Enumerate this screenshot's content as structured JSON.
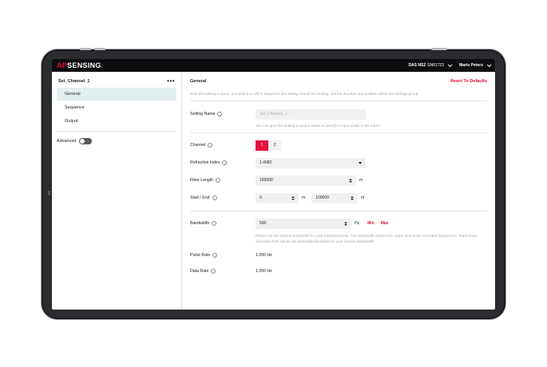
{
  "topbar": {
    "logo_ap": "AP",
    "logo_rest": "SENSING",
    "logo_dot": ".",
    "device_model": "DAS NS2",
    "device_serial": "SN81723",
    "user": "Mario Peters"
  },
  "sidebar": {
    "setting_name": "Set_Channel_1",
    "menu_label": "•••",
    "items": [
      "General",
      "Sequence",
      "Output"
    ],
    "active": "General",
    "advanced_label": "Advanced"
  },
  "main": {
    "title": "General",
    "reset_label": "Reset To Defaults",
    "description": "Give this setting a name, and define in which sequence this setting should be running. Set the duration and position within the settings group.",
    "setting_name": {
      "label": "Setting Name",
      "placeholder": "Set_Channel_1",
      "hint": "You can give this setting a unique name to identify it more easily in the future."
    },
    "channel": {
      "label": "Channel",
      "options": [
        "1",
        "2"
      ],
      "selected": "1"
    },
    "refractive_index": {
      "label": "Refractive Index",
      "value": "1.4682"
    },
    "fiber_length": {
      "label": "Fiber Length",
      "value": "100000",
      "unit": "m"
    },
    "start_end": {
      "label": "Start / End",
      "start": "0",
      "start_unit": "m",
      "end": "100000",
      "end_unit": "m"
    },
    "bandwidth": {
      "label": "Bandwidth",
      "value": "500",
      "unit": "Hz",
      "min_label": "Min",
      "max_label": "Max",
      "hint": "Please set the desired bandwidth for your measurements. The bandwidth defines the upper limit of the recorded frequencies. Pulse Rate and Data Rate will be set automatically based on your chosen Bandwidth."
    },
    "pulse_rate": {
      "label": "Pulse Rate",
      "value": "1,000 Hz"
    },
    "data_rate": {
      "label": "Data Rate",
      "value": "1,000 Hz"
    }
  },
  "colors": {
    "accent": "#e30f3c",
    "active_bg": "#e3eeee",
    "topbar_bg": "#0d0d0f"
  },
  "icons": [
    "info-icon",
    "chevron-down-icon",
    "caret-down-icon",
    "spinner-icon",
    "more-icon"
  ]
}
